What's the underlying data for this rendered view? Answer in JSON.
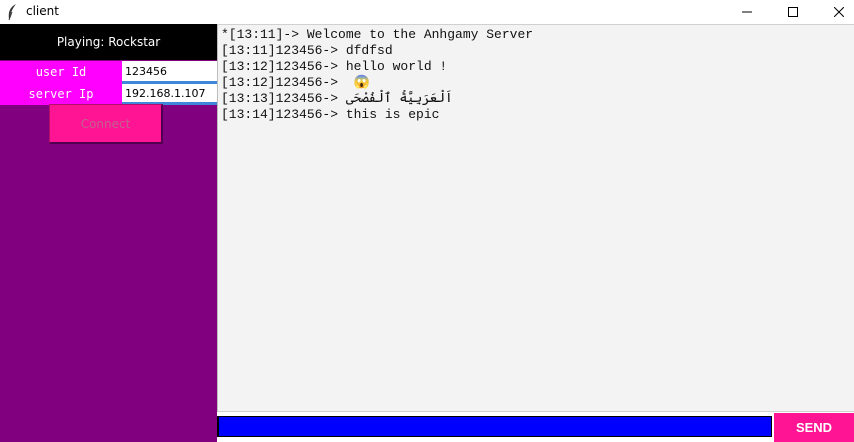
{
  "window": {
    "title": "client",
    "app_icon": "feather-icon",
    "controls": [
      "minimize-icon",
      "maximize-icon",
      "close-icon"
    ]
  },
  "sidebar": {
    "now_playing": "Playing: Rockstar",
    "user_id_label": "user Id",
    "user_id_value": "123456",
    "server_ip_label": "server Ip",
    "server_ip_value": "192.168.1.107",
    "connect_label": "Connect"
  },
  "chat": {
    "lines": [
      "*[13:11]-> Welcome to the Anhgamy Server",
      "[13:11]123456-> dfdfsd",
      "[13:12]123456-> hello world !",
      "[13:12]123456->  😱",
      "[13:13]123456-> اَلْعَرَبِيَّةُ ٱلْفُصْحَى",
      "[13:14]123456-> this is epic"
    ]
  },
  "composer": {
    "message_value": "",
    "send_label": "SEND"
  },
  "colors": {
    "sidebar_bg": "#800080",
    "label_bg": "#ff00ff",
    "button_bg": "#ff1493",
    "input_bg": "#0000ff"
  }
}
